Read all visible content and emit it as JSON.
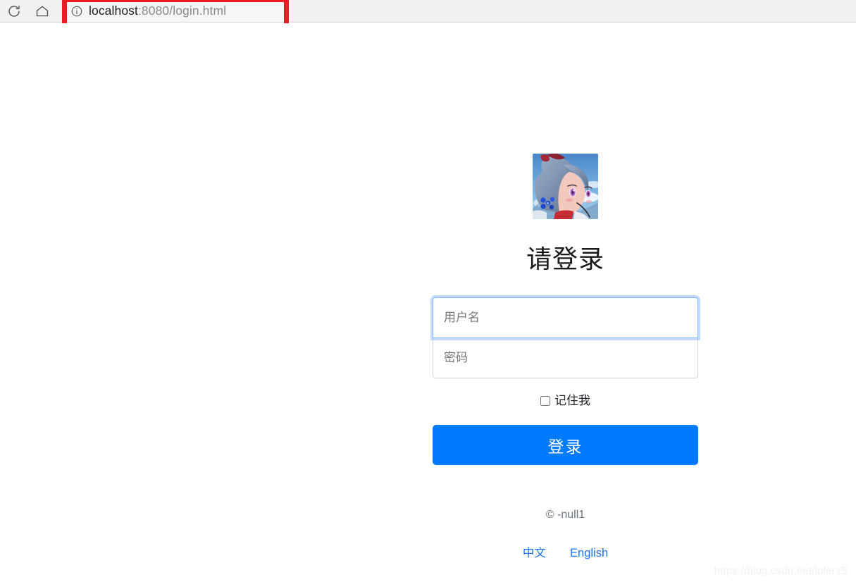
{
  "browser": {
    "reload_icon": "reload-icon",
    "home_icon": "home-icon",
    "site_info_icon": "info-circle-icon",
    "url_host": "localhost",
    "url_path": ":8080/login.html",
    "annotation_color": "#ed1c24"
  },
  "login": {
    "avatar_alt": "anime-character-avatar",
    "title": "请登录",
    "username_placeholder": "用户名",
    "username_value": "",
    "password_placeholder": "密码",
    "password_value": "",
    "remember_label": "记住我",
    "remember_checked": false,
    "submit_label": "登录",
    "button_color": "#007bff",
    "copyright": "© -null1",
    "languages": [
      {
        "label": "中文",
        "code": "zh"
      },
      {
        "label": "English",
        "code": "en"
      }
    ],
    "link_color": "#1a73f5"
  },
  "watermark": {
    "text": "https://blog.csdn.net/loler15"
  }
}
